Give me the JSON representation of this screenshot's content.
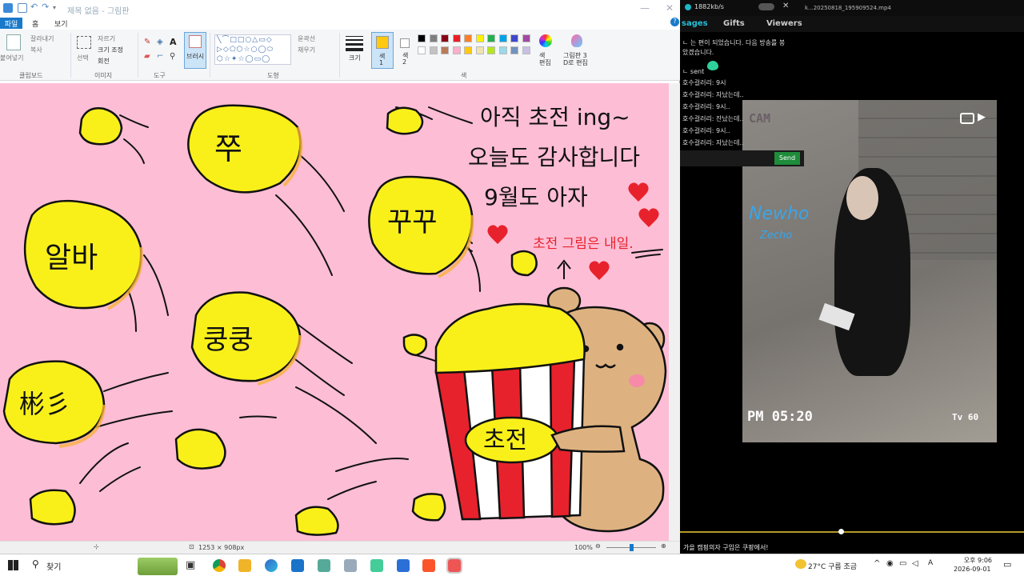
{
  "paint": {
    "title": "제목 없음 - 그림판",
    "menu": {
      "file": "파일",
      "home": "홈",
      "view": "보기"
    },
    "ribbon": {
      "clipboard_paste": "붙여넣기",
      "clipboard_cut": "잘라내기",
      "clipboard_copy": "복사",
      "image_select": "선택",
      "image_crop": "자르기",
      "image_resize": "크기 조정",
      "image_rotate": "회전",
      "brushes": "브러시",
      "outline": "윤곽선",
      "fill": "채우기",
      "size": "크기",
      "color1": "색\n1",
      "color2": "색\n2",
      "edit_colors": "색\n편집",
      "paint3d": "그림판 3\nD로 편집",
      "groups": {
        "clipboard": "클립보드",
        "image": "이미지",
        "tools": "도구",
        "shapes": "도형",
        "colors": "색"
      }
    },
    "palette": [
      "#000000",
      "#7f7f7f",
      "#880015",
      "#ed1c24",
      "#ff7f27",
      "#fff200",
      "#22b14c",
      "#00a2e8",
      "#3f48cc",
      "#a349a4",
      "#ffffff",
      "#c3c3c3",
      "#b97a57",
      "#ffaec9",
      "#ffc90e",
      "#efe4b0",
      "#b5e61d",
      "#99d9ea",
      "#7092be",
      "#c8bfe7"
    ],
    "status": {
      "size": "1253 × 908px",
      "zoom": "100%"
    }
  },
  "drawing": {
    "line1": "아직 초전 ing~",
    "line2": "오늘도 감사합니다",
    "line3": "9월도 아자",
    "note": "초전 그림은 내일.",
    "blob_jju": "쭈",
    "blob_kku": "꾸꾸",
    "blob_alba": "알바",
    "blob_kung": "쿵쿵",
    "blob_bin": "彬彡",
    "bucket_label": "초전"
  },
  "stream": {
    "speed": "1882kb/s",
    "file": "k...20250818_195909524.mp4",
    "tabs": {
      "messages": "sages",
      "gifts": "Gifts",
      "viewers": "Viewers"
    },
    "chat": [
      "ㄴ 는 편이 되었습니다. 다음 방송를 봉",
      "   았겠습니다.",
      "ㄴ sent",
      "호수걸러리: 9시",
      "호수걸러리: 자났는데..",
      "호수걸러리: 9시..",
      "호수걸러리: 잔났는데..",
      "호수걸러리: 9시..",
      "호수걸러리: 자났는데.."
    ],
    "send_label": "Send",
    "video": {
      "cam": "CAM",
      "brand1": "Newho",
      "brand2": "Zecho",
      "time": "PM 05:20",
      "tv": "Tv 60"
    },
    "ticker": "가을 캠핑의자 구입은 쿠팡에서!"
  },
  "taskbar": {
    "search": "찾기",
    "weather": "27°C  구름 조금",
    "time": "오후 9:06",
    "date": "2026-09-01"
  },
  "colors": {
    "canvas": "#fdbdd5",
    "popcorn": "#f9f01a",
    "paint_accent": "#1979ca",
    "send": "#1e8c3a"
  }
}
